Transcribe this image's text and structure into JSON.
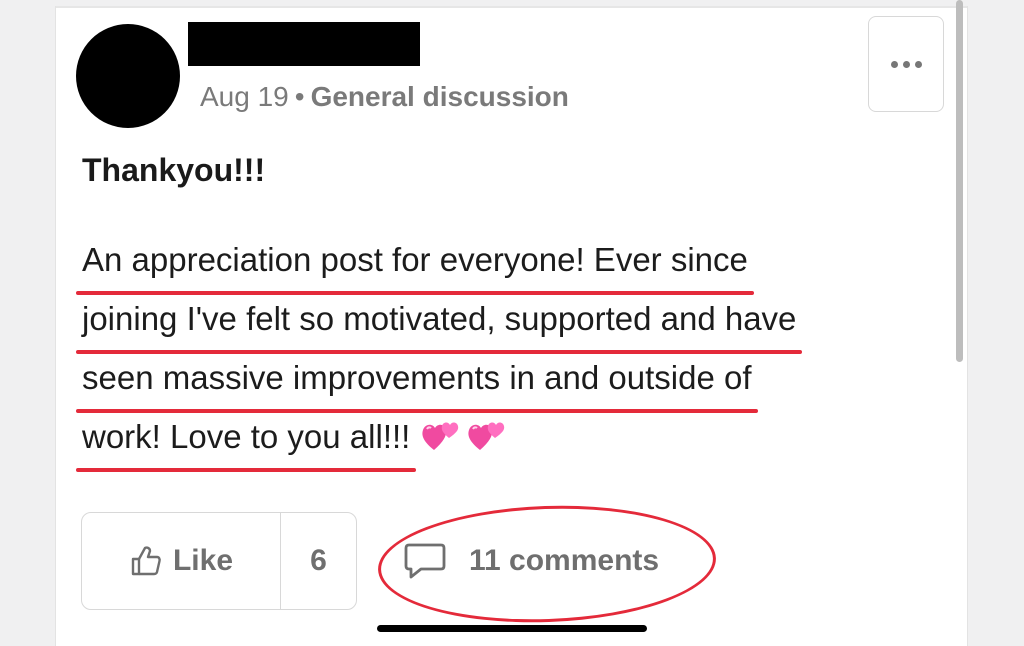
{
  "post": {
    "date": "Aug 19",
    "separator": "•",
    "category": "General discussion",
    "title": "Thankyou!!!",
    "body_lines": [
      "An appreciation post for everyone! Ever since",
      "joining I've felt so motivated, supported and have",
      "seen massive improvements in and outside of",
      "work! Love to you all!!!"
    ],
    "emoji": [
      "two-hearts",
      "two-hearts"
    ]
  },
  "actions": {
    "like_label": "Like",
    "like_count": "6",
    "comments_label": "11 comments"
  },
  "colors": {
    "annotation_red": "#e42a3a",
    "muted_text": "#7a7a7a",
    "heart_pink": "#f04aa0"
  },
  "icons": {
    "menu": "more-horizontal-icon",
    "like": "thumbs-up-icon",
    "comment": "speech-bubble-icon"
  }
}
